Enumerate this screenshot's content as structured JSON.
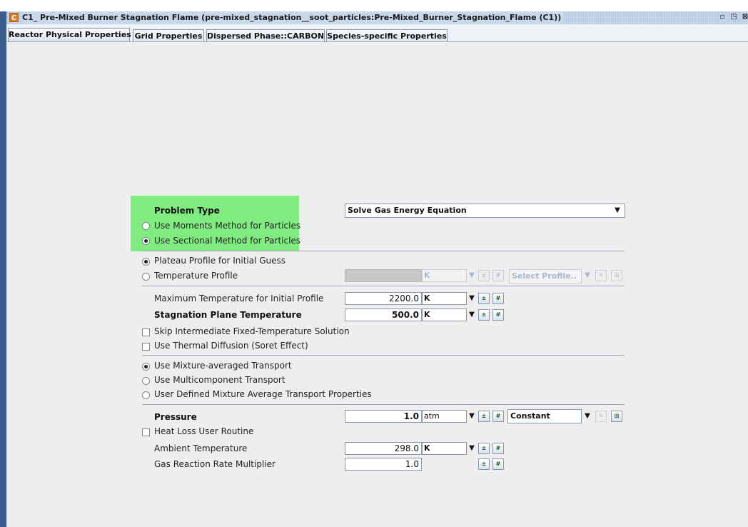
{
  "window": {
    "title": "C1_ Pre-Mixed Burner Stagnation Flame  (pre-mixed_stagnation__soot_particles:Pre-Mixed_Burner_Stagnation_Flame (C1))",
    "icon_letter": "C",
    "controls": [
      "minimize-icon",
      "maximize-icon",
      "close-icon"
    ]
  },
  "tabs": [
    {
      "label": "Reactor Physical Properties",
      "active": true
    },
    {
      "label": "Grid Properties",
      "active": false
    },
    {
      "label": "Dispersed Phase::CARBON",
      "active": false
    },
    {
      "label": "Species-specific Properties",
      "active": false
    }
  ],
  "problem": {
    "heading": "Problem Type",
    "option_moments": "Use Moments Method for Particles",
    "option_sectional": "Use Sectional Method for Particles",
    "selected": "sectional",
    "energy_select": "Solve Gas Energy Equation"
  },
  "guess": {
    "plateau": "Plateau Profile for Initial Guess",
    "temp_profile": "Temperature Profile",
    "selected": "plateau",
    "profile_unit": "K",
    "profile_select": "Select Profile.."
  },
  "temps": {
    "max_label": "Maximum Temperature for Initial Profile",
    "max_value": "2200.0",
    "max_unit": "K",
    "stag_label": "Stagnation Plane Temperature",
    "stag_value": "500.0",
    "stag_unit": "K",
    "skip_label": "Skip Intermediate Fixed-Temperature Solution",
    "thermal_label": "Use Thermal Diffusion (Soret Effect)"
  },
  "transport": {
    "mixture": "Use Mixture-averaged Transport",
    "multicomponent": "Use Multicomponent Transport",
    "user_defined": "User Defined Mixture Average Transport Properties",
    "selected": "mixture"
  },
  "pressure": {
    "label": "Pressure",
    "value": "1.0",
    "unit": "atm",
    "mode": "Constant"
  },
  "heat": {
    "heat_loss_label": "Heat Loss User Routine",
    "ambient_label": "Ambient Temperature",
    "ambient_value": "298.0",
    "ambient_unit": "K",
    "rate_label": "Gas Reaction Rate Multiplier",
    "rate_value": "1.0"
  },
  "colors": {
    "highlight": "#80ec80",
    "panel": "#eeeeee",
    "title_bar": "#c9d7eb"
  }
}
